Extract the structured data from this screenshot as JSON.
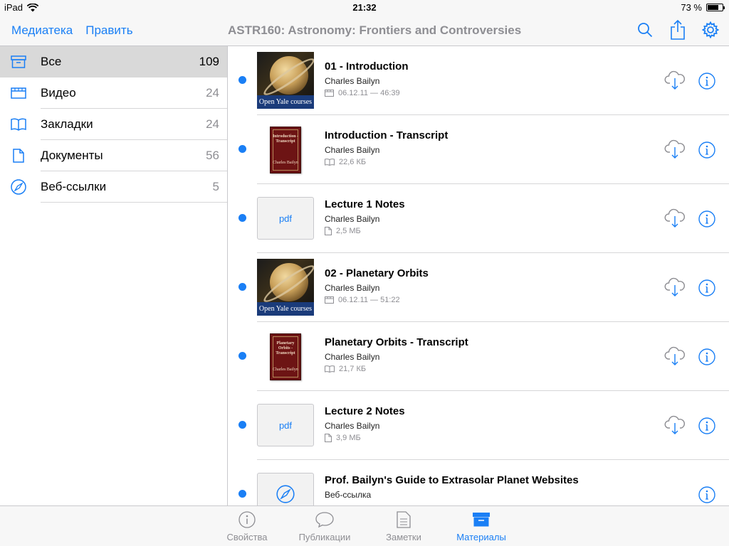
{
  "status": {
    "device": "iPad",
    "time": "21:32",
    "battery": "73 %",
    "battery_level": 0.73
  },
  "nav": {
    "left_buttons": [
      "Медиатека",
      "Править"
    ],
    "title": "ASTR160: Astronomy: Frontiers and Controversies",
    "right_icons": [
      "search-icon",
      "share-icon",
      "gear-icon"
    ]
  },
  "sidebar": {
    "items": [
      {
        "label": "Все",
        "count": "109",
        "icon": "all-icon",
        "active": true
      },
      {
        "label": "Видео",
        "count": "24",
        "icon": "video-icon"
      },
      {
        "label": "Закладки",
        "count": "24",
        "icon": "book-icon"
      },
      {
        "label": "Документы",
        "count": "56",
        "icon": "document-icon"
      },
      {
        "label": "Веб-ссылки",
        "count": "5",
        "icon": "compass-icon"
      }
    ]
  },
  "list": {
    "items": [
      {
        "title": "01 - Introduction",
        "author": "Charles Bailyn",
        "meta": "06.12.11 — 46:39",
        "thumb": "video",
        "thumb_text": "Open Yale courses",
        "meta_icon": "video-icon"
      },
      {
        "title": "Introduction - Transcript",
        "author": "Charles Bailyn",
        "meta": "22,6 КБ",
        "thumb": "book",
        "book_title": "Introduction - Transcript",
        "book_author": "Charles Bailyn",
        "meta_icon": "book-icon"
      },
      {
        "title": "Lecture 1 Notes",
        "author": "Charles Bailyn",
        "meta": "2,5 МБ",
        "thumb": "pdf",
        "thumb_text": "pdf",
        "meta_icon": "document-icon"
      },
      {
        "title": "02 - Planetary Orbits",
        "author": "Charles Bailyn",
        "meta": "06.12.11 — 51:22",
        "thumb": "video",
        "thumb_text": "Open Yale courses",
        "meta_icon": "video-icon"
      },
      {
        "title": "Planetary Orbits - Transcript",
        "author": "Charles Bailyn",
        "meta": "21,7 КБ",
        "thumb": "book",
        "book_title": "Planetary Orbits - Transcript",
        "book_author": "Charles Bailyn",
        "meta_icon": "book-icon"
      },
      {
        "title": "Lecture 2 Notes",
        "author": "Charles Bailyn",
        "meta": "3,9 МБ",
        "thumb": "pdf",
        "thumb_text": "pdf",
        "meta_icon": "document-icon"
      },
      {
        "title": "Prof. Bailyn's Guide to Extrasolar Planet Websites",
        "author": "Веб-ссылка",
        "meta": "",
        "thumb": "web",
        "meta_icon": "compass-icon"
      }
    ]
  },
  "tabs": [
    {
      "label": "Свойства",
      "icon": "info-icon"
    },
    {
      "label": "Публикации",
      "icon": "speech-bubble-icon"
    },
    {
      "label": "Заметки",
      "icon": "notes-icon"
    },
    {
      "label": "Материалы",
      "icon": "archive-box-icon",
      "active": true
    }
  ],
  "colors": {
    "accent": "#1a7ff5",
    "dot": "#1a7ff5",
    "active_row": "#d9d9d9"
  }
}
